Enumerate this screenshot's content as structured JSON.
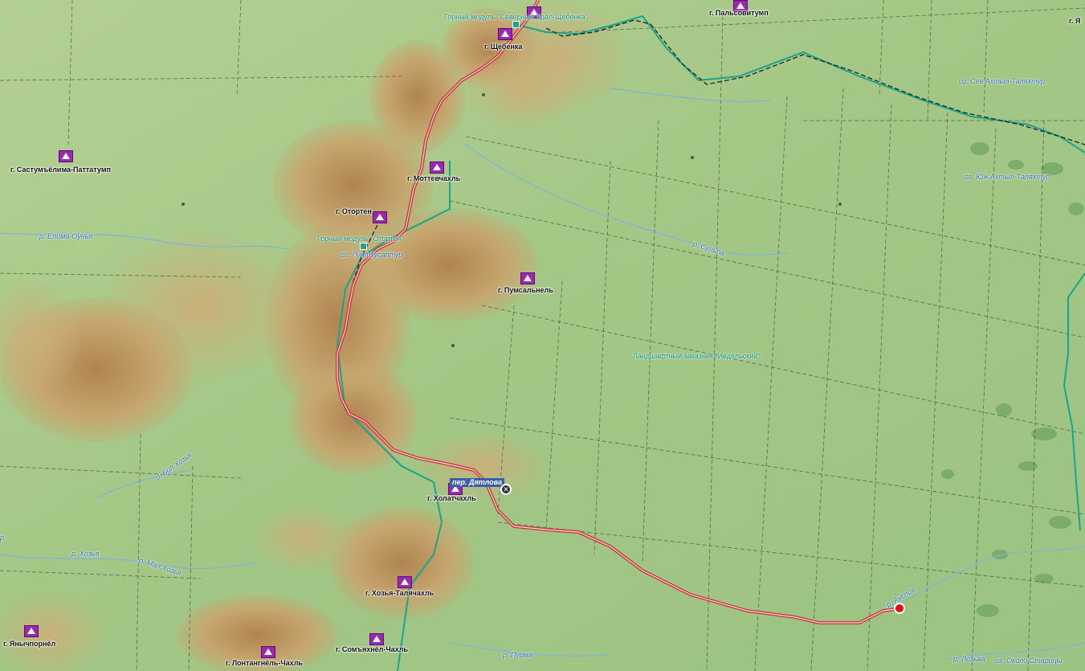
{
  "colors": {
    "lowland": "#a7c98a",
    "terrain_mid": "#cbb27a",
    "terrain_high": "#b08450",
    "route": "#e05a5a",
    "zone_border": "#17a58c",
    "marker": "#e01010"
  },
  "peaks": [
    {
      "name": "г. Пальсовитумп",
      "icon": "peak-icon"
    },
    {
      "name": "г. Щебенка",
      "icon": "peak-icon"
    },
    {
      "name": "г. Састумъёлима-Паттатумп",
      "icon": "peak-icon"
    },
    {
      "name": "г. Моттевчахль",
      "icon": "peak-icon"
    },
    {
      "name": "г. Отортен",
      "icon": "peak-icon"
    },
    {
      "name": "г. Пумсальнель",
      "icon": "peak-icon"
    },
    {
      "name": "г. Холатчахль",
      "icon": "peak-icon"
    },
    {
      "name": "г. Хозья-Талячахль",
      "icon": "peak-icon"
    },
    {
      "name": "г. Янычпорнёл",
      "icon": "peak-icon"
    },
    {
      "name": "г. Сомъяхнёл-Чахль",
      "icon": "peak-icon"
    },
    {
      "name": "г. Лонтангнёль-Чахль",
      "icon": "peak-icon"
    },
    {
      "name": "г. Я",
      "icon": "peak-icon"
    }
  ],
  "modules": [
    {
      "name": "Горный модуль \"Северный Урал-Щебенка\"",
      "icon": "module-icon"
    },
    {
      "name": "Горный модуль \"Отортен\"",
      "icon": "module-icon"
    }
  ],
  "water": [
    "оз. Сев.Ахтыл-Таляхтур",
    "оз. Юж.Ахтыл-Таляхтур",
    "р. Елима-Оунья",
    "оз. Лунтхусаптур",
    "р. Сульпа",
    "р. Бол.Хозья",
    "р. Хозья",
    "р. Мал.Хозья",
    "р. Пурма",
    "р. Ауспия",
    "р. Лозьва",
    "оз. Около Старицы",
    "р"
  ],
  "zone": "Ландшафтный заказник \"Ивдельский\"",
  "pass": "пер. Дятлова",
  "memorial_icon": "memorial-icon",
  "end_marker_icon": "map-marker-icon"
}
